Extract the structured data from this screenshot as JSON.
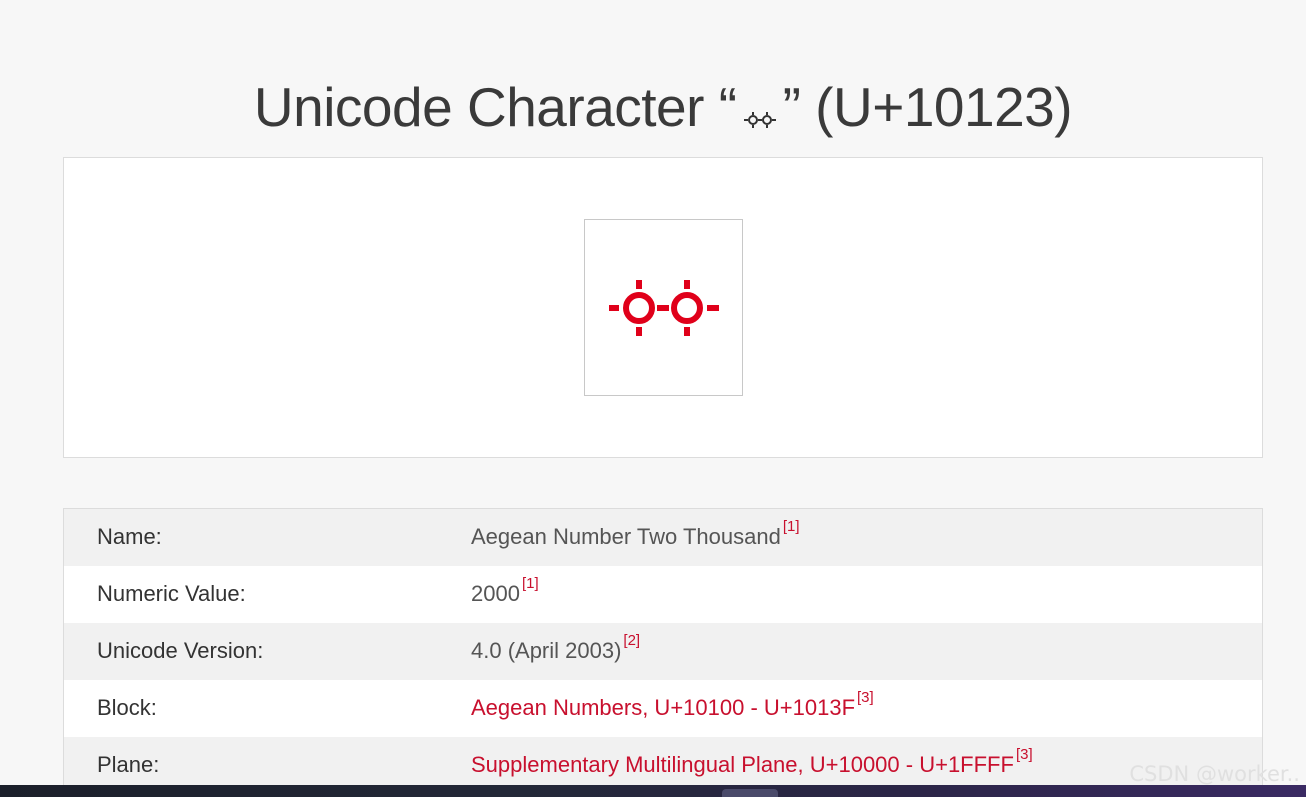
{
  "page": {
    "title_prefix": "Unicode Character “",
    "title_suffix": "” (U+10123)",
    "glyph_icon": "aegean-number-two-thousand-glyph",
    "accent_color": "#c8102e"
  },
  "properties": [
    {
      "label": "Name:",
      "value": "Aegean Number Two Thousand",
      "ref": "[1]",
      "link": false
    },
    {
      "label": "Numeric Value:",
      "value": "2000",
      "ref": "[1]",
      "link": false
    },
    {
      "label": "Unicode Version:",
      "value": "4.0 (April 2003)",
      "ref": "[2]",
      "link": false
    },
    {
      "label": "Block:",
      "value": "Aegean Numbers, U+10100 - U+1013F",
      "ref": "[3]",
      "link": true
    },
    {
      "label": "Plane:",
      "value": "Supplementary Multilingual Plane, U+10000 - U+1FFFF",
      "ref": "[3]",
      "link": true
    }
  ],
  "watermark": "CSDN @worker.."
}
